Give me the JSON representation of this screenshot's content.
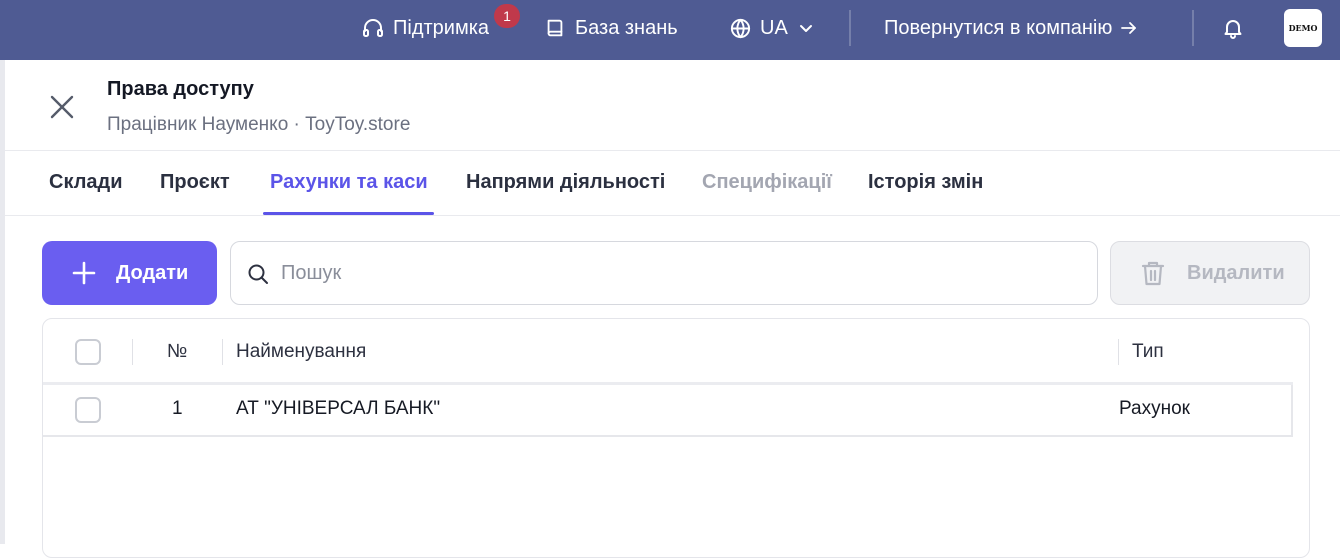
{
  "topbar": {
    "support_label": "Підтримка",
    "support_badge": "1",
    "knowledge_label": "База знань",
    "language": "UA",
    "back_label": "Повернутися в компанію",
    "avatar_text": "DEMO",
    "colors": {
      "bar": "#4f5b93",
      "badge": "#c0394b"
    }
  },
  "panel": {
    "title": "Права доступу",
    "subtitle": "Працівник Науменко · ToyToy.store"
  },
  "tabs": [
    {
      "label": "Склади",
      "state": "normal"
    },
    {
      "label": "Проєкт",
      "state": "normal"
    },
    {
      "label": "Рахунки та каси",
      "state": "active"
    },
    {
      "label": "Напрями діяльності",
      "state": "normal"
    },
    {
      "label": "Специфікації",
      "state": "disabled"
    },
    {
      "label": "Історія змін",
      "state": "normal"
    }
  ],
  "toolbar": {
    "add_label": "Додати",
    "search_placeholder": "Пошук",
    "delete_label": "Видалити",
    "accent": "#6a5ef0"
  },
  "table": {
    "headers": {
      "number": "№",
      "name": "Найменування",
      "type": "Тип"
    },
    "rows": [
      {
        "number": "1",
        "name": "АТ \"УНІВЕРСАЛ БАНК\"",
        "type": "Рахунок"
      }
    ]
  }
}
